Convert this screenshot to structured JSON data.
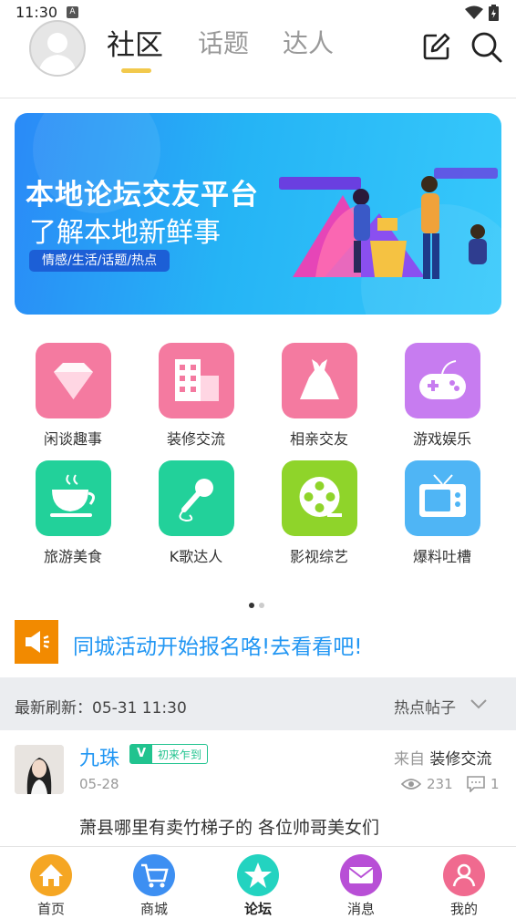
{
  "status_bar": {
    "time": "11:30",
    "notif_letter": "A"
  },
  "header": {
    "tabs": [
      {
        "label": "社区",
        "active": true
      },
      {
        "label": "话题",
        "active": false
      },
      {
        "label": "达人",
        "active": false
      }
    ],
    "accent_color": "#f2c94c"
  },
  "banner": {
    "title": "本地论坛交友平台",
    "subtitle": "了解本地新鲜事",
    "tags": "情感/生活/话题/热点"
  },
  "categories": [
    {
      "label": "闲谈趣事",
      "icon": "diamond-icon",
      "color": "#f47aa0"
    },
    {
      "label": "装修交流",
      "icon": "building-icon",
      "color": "#f47aa0"
    },
    {
      "label": "相亲交友",
      "icon": "dress-icon",
      "color": "#f47aa0"
    },
    {
      "label": "游戏娱乐",
      "icon": "gamepad-icon",
      "color": "#c77cf0"
    },
    {
      "label": "旅游美食",
      "icon": "cup-icon",
      "color": "#22d19a"
    },
    {
      "label": "K歌达人",
      "icon": "microphone-icon",
      "color": "#22d19a"
    },
    {
      "label": "影视综艺",
      "icon": "film-reel-icon",
      "color": "#8fd42a"
    },
    {
      "label": "爆料吐槽",
      "icon": "tv-icon",
      "color": "#4fb5f5"
    }
  ],
  "pager": {
    "count": 2,
    "active": 0
  },
  "notice": {
    "text": "同城活动开始报名咯!去看看吧!",
    "icon": "speaker-icon",
    "color": "#f28a00"
  },
  "refresh": {
    "label": "最新刷新：05-31 11:30",
    "sort_label": "热点帖子"
  },
  "post": {
    "author": "九珠",
    "level": "V",
    "level_title": "初来乍到",
    "date": "05-28",
    "from_label": "来自",
    "board": "装修交流",
    "views": "231",
    "comments": "1",
    "content": "萧县哪里有卖竹梯子的 各位帅哥美女们"
  },
  "bottom_nav": [
    {
      "label": "首页",
      "icon": "home-icon",
      "color": "#f5a623"
    },
    {
      "label": "商城",
      "icon": "cart-icon",
      "color": "#3d8ff2"
    },
    {
      "label": "论坛",
      "icon": "star-icon",
      "color": "#23d3c0",
      "active": true
    },
    {
      "label": "消息",
      "icon": "mail-icon",
      "color": "#b84fd6"
    },
    {
      "label": "我的",
      "icon": "user-icon",
      "color": "#f06a8f"
    }
  ]
}
